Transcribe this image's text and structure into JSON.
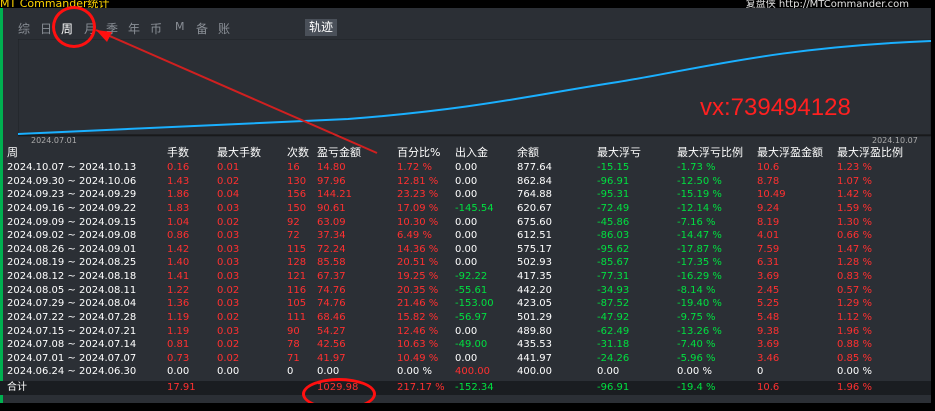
{
  "window": {
    "title_left": "MT Commander统计",
    "title_right": "复盘侠 http://MTCommander.com"
  },
  "tabs": [
    {
      "label": "综"
    },
    {
      "label": "日"
    },
    {
      "label": "周"
    },
    {
      "label": "月"
    },
    {
      "label": "季"
    },
    {
      "label": "年"
    },
    {
      "label": "币"
    },
    {
      "label": "M"
    },
    {
      "label": "备"
    },
    {
      "label": "账户"
    }
  ],
  "trajectory_button": "轨迹",
  "chart_data": {
    "type": "line",
    "x_start": "2024.07.01",
    "x_end": "2024.10.07",
    "color": "#1ab0ff"
  },
  "watermark": "vx:739494128",
  "table": {
    "headers": [
      "周",
      "手数",
      "最大手数",
      "次数",
      "盈亏金额",
      "百分比%",
      "出入金",
      "余额",
      "最大浮亏",
      "最大浮亏比例",
      "最大浮盈金额",
      "最大浮盈比例"
    ],
    "rows": [
      [
        "2024.10.07 ~ 2024.10.13",
        "0.16",
        "0.01",
        "16",
        "14.80",
        "1.72 %",
        "0.00",
        "877.64",
        "-15.15",
        "-1.73 %",
        "10.6",
        "1.23 %"
      ],
      [
        "2024.09.30 ~ 2024.10.06",
        "1.43",
        "0.02",
        "130",
        "97.96",
        "12.81 %",
        "0.00",
        "862.84",
        "-96.91",
        "-12.50 %",
        "8.78",
        "1.07 %"
      ],
      [
        "2024.09.23 ~ 2024.09.29",
        "1.86",
        "0.04",
        "156",
        "144.21",
        "23.23 %",
        "0.00",
        "764.88",
        "-95.31",
        "-15.19 %",
        "10.49",
        "1.42 %"
      ],
      [
        "2024.09.16 ~ 2024.09.22",
        "1.83",
        "0.03",
        "150",
        "90.61",
        "17.09 %",
        "-145.54",
        "620.67",
        "-72.49",
        "-12.14 %",
        "9.24",
        "1.59 %"
      ],
      [
        "2024.09.09 ~ 2024.09.15",
        "1.04",
        "0.02",
        "92",
        "63.09",
        "10.30 %",
        "0.00",
        "675.60",
        "-45.86",
        "-7.16 %",
        "8.19",
        "1.30 %"
      ],
      [
        "2024.09.02 ~ 2024.09.08",
        "0.86",
        "0.03",
        "72",
        "37.34",
        "6.49 %",
        "0.00",
        "612.51",
        "-86.03",
        "-14.47 %",
        "4.01",
        "0.66 %"
      ],
      [
        "2024.08.26 ~ 2024.09.01",
        "1.42",
        "0.03",
        "115",
        "72.24",
        "14.36 %",
        "0.00",
        "575.17",
        "-95.62",
        "-17.87 %",
        "7.59",
        "1.47 %"
      ],
      [
        "2024.08.19 ~ 2024.08.25",
        "1.40",
        "0.03",
        "128",
        "85.58",
        "20.51 %",
        "0.00",
        "502.93",
        "-85.67",
        "-17.35 %",
        "6.31",
        "1.28 %"
      ],
      [
        "2024.08.12 ~ 2024.08.18",
        "1.41",
        "0.03",
        "121",
        "67.37",
        "19.25 %",
        "-92.22",
        "417.35",
        "-77.31",
        "-16.29 %",
        "3.69",
        "0.83 %"
      ],
      [
        "2024.08.05 ~ 2024.08.11",
        "1.22",
        "0.02",
        "116",
        "74.76",
        "20.35 %",
        "-55.61",
        "442.20",
        "-34.93",
        "-8.14 %",
        "2.45",
        "0.57 %"
      ],
      [
        "2024.07.29 ~ 2024.08.04",
        "1.36",
        "0.03",
        "105",
        "74.76",
        "21.46 %",
        "-153.00",
        "423.05",
        "-87.52",
        "-19.40 %",
        "5.25",
        "1.29 %"
      ],
      [
        "2024.07.22 ~ 2024.07.28",
        "1.19",
        "0.02",
        "111",
        "68.46",
        "15.82 %",
        "-56.97",
        "501.29",
        "-47.92",
        "-9.75 %",
        "5.48",
        "1.12 %"
      ],
      [
        "2024.07.15 ~ 2024.07.21",
        "1.19",
        "0.03",
        "90",
        "54.27",
        "12.46 %",
        "0.00",
        "489.80",
        "-62.49",
        "-13.26 %",
        "9.38",
        "1.96 %"
      ],
      [
        "2024.07.08 ~ 2024.07.14",
        "0.81",
        "0.02",
        "78",
        "42.56",
        "10.63 %",
        "-49.00",
        "435.53",
        "-31.18",
        "-7.40 %",
        "3.69",
        "0.88 %"
      ],
      [
        "2024.07.01 ~ 2024.07.07",
        "0.73",
        "0.02",
        "71",
        "41.97",
        "10.49 %",
        "0.00",
        "441.97",
        "-24.26",
        "-5.96 %",
        "3.46",
        "0.85 %"
      ],
      [
        "2024.06.24 ~ 2024.06.30",
        "0.00",
        "0.00",
        "0",
        "0.00",
        "0.00 %",
        "400.00",
        "400.00",
        "0.00",
        "0.00 %",
        "0",
        "0.00 %"
      ]
    ],
    "total": [
      "合计",
      "17.91",
      "",
      "",
      "1029.98",
      "217.17 %",
      "-152.34",
      "",
      "-96.91",
      "-19.4 %",
      "10.6",
      "1.96 %"
    ]
  }
}
